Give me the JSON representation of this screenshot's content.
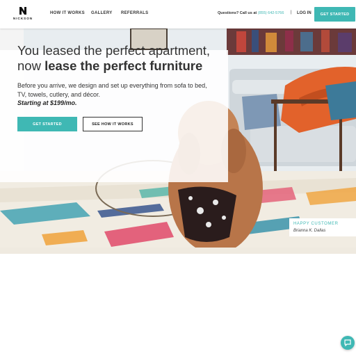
{
  "brand": {
    "name": "NICKSON"
  },
  "nav": {
    "how_it_works": "HOW IT WORKS",
    "gallery": "GALLERY",
    "referrals": "REFERRALS"
  },
  "contact": {
    "prefix": "Questions? Call us at",
    "phone": "(855) 642-5766",
    "separator": "|"
  },
  "header": {
    "login": "LOG IN",
    "cta": "GET STARTED"
  },
  "hero": {
    "headline_light": "You leased the perfect apartment, now",
    "headline_bold": "lease the perfect furniture",
    "description": "Before you arrive, we design and set up everything from sofa to bed, TV, towels, cutlery, and décor.",
    "price": "Starting at $199/mo.",
    "primary_button": "GET STARTED",
    "secondary_button": "SEE HOW IT WORKS"
  },
  "testimonial": {
    "label": "HAPPY CUSTOMER",
    "name": "Brianna K. Dallas"
  },
  "colors": {
    "accent": "#3fb8b4",
    "text": "#333333",
    "orange_throw": "#e2622b"
  },
  "icons": [
    "nickson-logo-icon",
    "chevron-right-icon",
    "chat-icon"
  ]
}
